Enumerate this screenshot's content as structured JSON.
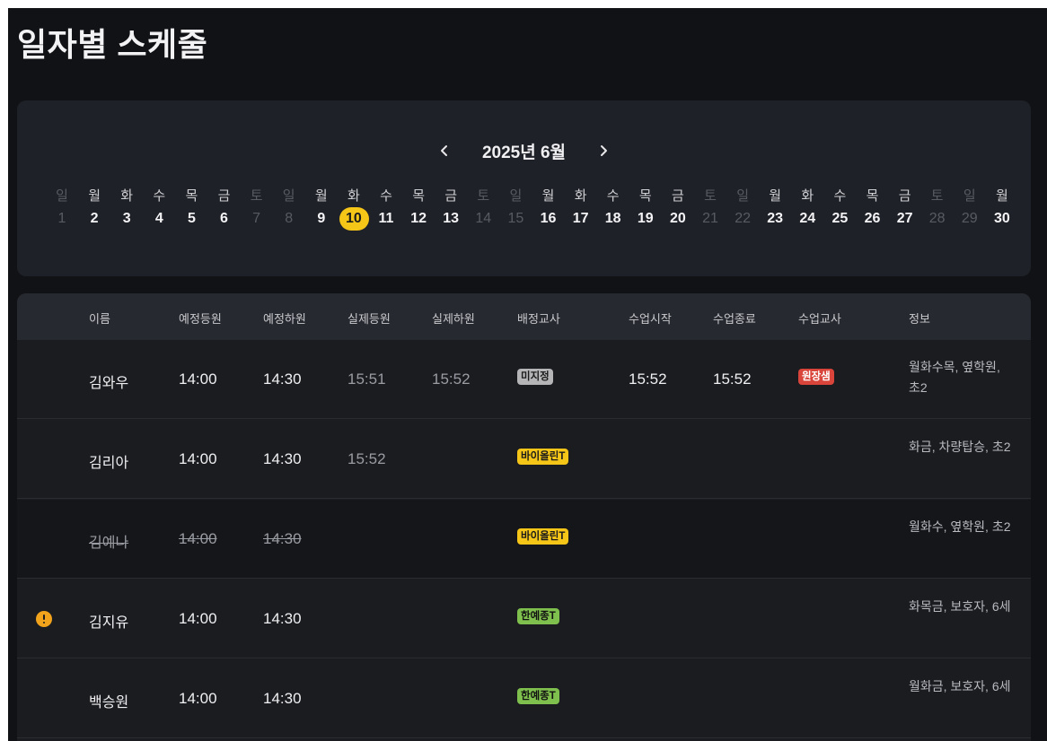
{
  "page": {
    "title": "일자별 스케줄"
  },
  "calendar": {
    "month_label": "2025년 6월",
    "selected_day": "10",
    "days": [
      {
        "wd": "일",
        "d": "1",
        "weekend": true
      },
      {
        "wd": "월",
        "d": "2",
        "weekend": false
      },
      {
        "wd": "화",
        "d": "3",
        "weekend": false
      },
      {
        "wd": "수",
        "d": "4",
        "weekend": false
      },
      {
        "wd": "목",
        "d": "5",
        "weekend": false
      },
      {
        "wd": "금",
        "d": "6",
        "weekend": false
      },
      {
        "wd": "토",
        "d": "7",
        "weekend": true
      },
      {
        "wd": "일",
        "d": "8",
        "weekend": true
      },
      {
        "wd": "월",
        "d": "9",
        "weekend": false
      },
      {
        "wd": "화",
        "d": "10",
        "weekend": false
      },
      {
        "wd": "수",
        "d": "11",
        "weekend": false
      },
      {
        "wd": "목",
        "d": "12",
        "weekend": false
      },
      {
        "wd": "금",
        "d": "13",
        "weekend": false
      },
      {
        "wd": "토",
        "d": "14",
        "weekend": true
      },
      {
        "wd": "일",
        "d": "15",
        "weekend": true
      },
      {
        "wd": "월",
        "d": "16",
        "weekend": false
      },
      {
        "wd": "화",
        "d": "17",
        "weekend": false
      },
      {
        "wd": "수",
        "d": "18",
        "weekend": false
      },
      {
        "wd": "목",
        "d": "19",
        "weekend": false
      },
      {
        "wd": "금",
        "d": "20",
        "weekend": false
      },
      {
        "wd": "토",
        "d": "21",
        "weekend": true
      },
      {
        "wd": "일",
        "d": "22",
        "weekend": true
      },
      {
        "wd": "월",
        "d": "23",
        "weekend": false
      },
      {
        "wd": "화",
        "d": "24",
        "weekend": false
      },
      {
        "wd": "수",
        "d": "25",
        "weekend": false
      },
      {
        "wd": "목",
        "d": "26",
        "weekend": false
      },
      {
        "wd": "금",
        "d": "27",
        "weekend": false
      },
      {
        "wd": "토",
        "d": "28",
        "weekend": true
      },
      {
        "wd": "일",
        "d": "29",
        "weekend": true
      },
      {
        "wd": "월",
        "d": "30",
        "weekend": false
      }
    ]
  },
  "table": {
    "headers": {
      "name": "이름",
      "planned_in": "예정등원",
      "planned_out": "예정하원",
      "actual_in": "실제등원",
      "actual_out": "실제하원",
      "assigned_teacher": "배정교사",
      "class_start": "수업시작",
      "class_end": "수업종료",
      "class_teacher": "수업교사",
      "info": "정보"
    },
    "rows": [
      {
        "name": "김와우",
        "planned_in": "14:00",
        "planned_out": "14:30",
        "actual_in": "15:51",
        "actual_out": "15:52",
        "assigned_teacher": "미지정",
        "assigned_color": "gray",
        "class_start": "15:52",
        "class_end": "15:52",
        "class_teacher": "원장샘",
        "info": "월화수목, 옆학원, 초2",
        "cancelled": false,
        "warning": false
      },
      {
        "name": "김리아",
        "planned_in": "14:00",
        "planned_out": "14:30",
        "actual_in": "15:52",
        "actual_out": "",
        "assigned_teacher": "바이올린T",
        "assigned_color": "yellow",
        "class_start": "",
        "class_end": "",
        "class_teacher": "",
        "info": "화금, 차량탑승, 초2",
        "cancelled": false,
        "warning": false
      },
      {
        "name": "김예나",
        "planned_in": "14:00",
        "planned_out": "14:30",
        "actual_in": "",
        "actual_out": "",
        "assigned_teacher": "바이올린T",
        "assigned_color": "yellow",
        "class_start": "",
        "class_end": "",
        "class_teacher": "",
        "info": "월화수, 옆학원, 초2",
        "cancelled": true,
        "warning": false
      },
      {
        "name": "김지유",
        "planned_in": "14:00",
        "planned_out": "14:30",
        "actual_in": "",
        "actual_out": "",
        "assigned_teacher": "한예종T",
        "assigned_color": "green",
        "class_start": "",
        "class_end": "",
        "class_teacher": "",
        "info": "화목금, 보호자, 6세",
        "cancelled": false,
        "warning": true
      },
      {
        "name": "백승원",
        "planned_in": "14:00",
        "planned_out": "14:30",
        "actual_in": "",
        "actual_out": "",
        "assigned_teacher": "한예종T",
        "assigned_color": "green",
        "class_start": "",
        "class_end": "",
        "class_teacher": "",
        "info": "월화금, 보호자, 6세",
        "cancelled": false,
        "warning": false
      }
    ]
  }
}
